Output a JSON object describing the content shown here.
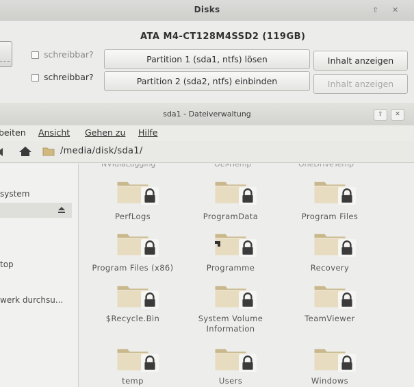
{
  "disks": {
    "title": "Disks",
    "disk_name": "ATA M4-CT128M4SSD2 (119GB)",
    "partitions": [
      {
        "writable_label": "schreibbar?",
        "action_label": "Partition 1 (sda1, ntfs) lösen",
        "content_label": "Inhalt anzeigen",
        "content_enabled": true
      },
      {
        "writable_label": "schreibbar?",
        "action_label": "Partition 2 (sda2, ntfs) einbinden",
        "content_label": "Inhalt anzeigen",
        "content_enabled": false
      }
    ]
  },
  "filemanager": {
    "title": "sda1 - Dateiverwaltung",
    "menu": [
      "beiten",
      "Ansicht",
      "Gehen zu",
      "Hilfe"
    ],
    "path": "/media/disk/sda1/",
    "sidebar": [
      "system",
      "top",
      "werk durchsu..."
    ],
    "cut_labels": [
      "NVIdiaLogging",
      "OEMTemp",
      "OneDriveTemp"
    ],
    "items": [
      {
        "name": "PerfLogs",
        "type": "folder",
        "locked": true
      },
      {
        "name": "ProgramData",
        "type": "folder",
        "locked": true
      },
      {
        "name": "Program Files",
        "type": "folder",
        "locked": true
      },
      {
        "name": "Program Files (x86)",
        "type": "folder",
        "locked": true
      },
      {
        "name": "Programme",
        "type": "folder-link",
        "locked": true
      },
      {
        "name": "Recovery",
        "type": "folder",
        "locked": true
      },
      {
        "name": "$Recycle.Bin",
        "type": "folder",
        "locked": true
      },
      {
        "name": "System Volume Information",
        "type": "folder",
        "locked": true
      },
      {
        "name": "TeamViewer",
        "type": "folder",
        "locked": true
      },
      {
        "name": "temp",
        "type": "folder",
        "locked": true
      },
      {
        "name": "Users",
        "type": "folder",
        "locked": true
      },
      {
        "name": "Windows",
        "type": "folder",
        "locked": true
      }
    ]
  },
  "colors": {
    "folder_light": "#e7dcc0",
    "folder_dark": "#c9b88c",
    "lock": "#3b3b3b"
  }
}
